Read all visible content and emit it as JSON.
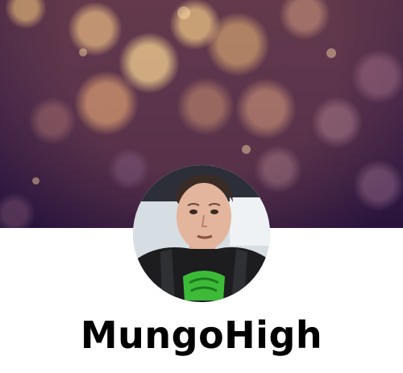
{
  "profile": {
    "username": "MungoHigh",
    "avatar_icon": "user-photo-avatar",
    "cover_icon": "bokeh-cover-image"
  },
  "colors": {
    "background": "#ffffff",
    "cover_dark": "#2a143c",
    "cover_bokeh": "#ffd28a",
    "username_text": "#000000"
  }
}
